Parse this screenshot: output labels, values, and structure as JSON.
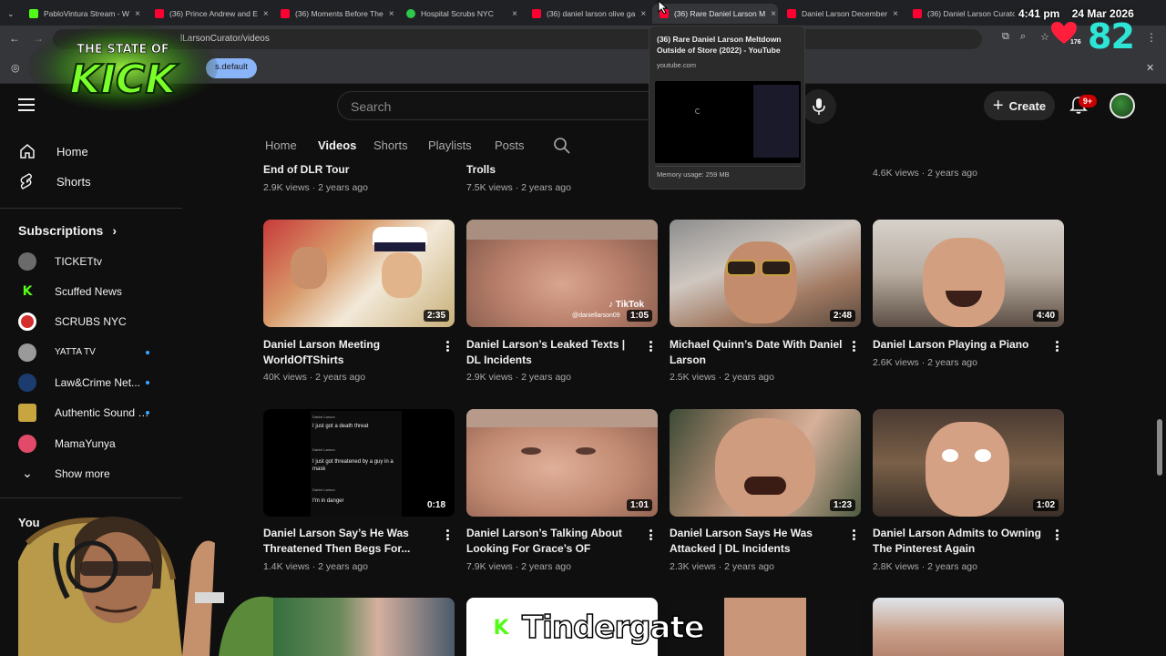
{
  "browser": {
    "tabs": [
      {
        "title": "PabloVintura Stream - W",
        "favicon": "kick"
      },
      {
        "title": "(36) Prince Andrew and E",
        "favicon": "youtube"
      },
      {
        "title": "(36) Moments Before The",
        "favicon": "youtube"
      },
      {
        "title": "Hospital Scrubs NYC",
        "favicon": "green"
      },
      {
        "title": "(36) daniel larson olive ga",
        "favicon": "youtube"
      },
      {
        "title": "(36) Rare Daniel Larson M",
        "favicon": "youtube",
        "active": true
      },
      {
        "title": "Daniel Larson December",
        "favicon": "youtube"
      },
      {
        "title": "(36) Daniel Larson Curato",
        "favicon": "youtube"
      }
    ],
    "url": "lLarsonCurator/videos",
    "bookmark_chip": "s.default"
  },
  "hover_card": {
    "title": "(36) Rare Daniel Larson Meltdown Outside of Store (2022) - YouTube",
    "domain": "youtube.com",
    "memory": "Memory usage: 259 MB"
  },
  "stream_overlay": {
    "logo_text_top": "THE STATE OF",
    "logo_text_main": "KICK",
    "time": "4:41 pm",
    "date": "24 Mar 2026",
    "heart_count": "176",
    "viewer_count": "82",
    "ticker_text": "Tindergate",
    "ticker_logo": "K"
  },
  "youtube": {
    "search_placeholder": "Search",
    "create_label": "Create",
    "notification_badge": "9+",
    "sidebar": {
      "home": "Home",
      "shorts": "Shorts",
      "subscriptions_title": "Subscriptions",
      "subscriptions": [
        {
          "name": "TICKETtv",
          "color": "#6b6b6b",
          "dot": false
        },
        {
          "name": "Scuffed News",
          "color": "#53fc18",
          "dot": false
        },
        {
          "name": "SCRUBS NYC",
          "color": "#d32f2f",
          "dot": false
        },
        {
          "name": "YATTA TV",
          "color": "#9a9a9a",
          "dot": true
        },
        {
          "name": "Law&Crime Net...",
          "color": "#1c3b6e",
          "dot": true
        },
        {
          "name": "Authentic Sound Ef...",
          "color": "#c7a640",
          "dot": true
        },
        {
          "name": "MamaYunya",
          "color": "#e24a6a",
          "dot": false
        }
      ],
      "show_more": "Show more",
      "you_label": "You"
    },
    "channel_tabs": [
      "Home",
      "Videos",
      "Shorts",
      "Playlists",
      "Posts"
    ],
    "active_tab": "Videos",
    "top_row_partial": [
      {
        "title": "End of DLR Tour",
        "meta": "2.9K views · 2 years ago"
      },
      {
        "title": "Trolls",
        "meta": "7.5K views · 2 years ago"
      },
      {
        "title": "",
        "meta": "4.6K views · 2 years ago"
      }
    ],
    "videos_row1": [
      {
        "title": "Daniel Larson Meeting WorldOfTShirts",
        "meta": "40K views · 2 years ago",
        "duration": "2:35"
      },
      {
        "title": "Daniel Larson’s Leaked Texts | DL Incidents",
        "meta": "2.9K views · 2 years ago",
        "duration": "1:05",
        "watermark": "@daniellarson09"
      },
      {
        "title": "Michael Quinn’s Date With Daniel Larson",
        "meta": "2.5K views · 2 years ago",
        "duration": "2:48"
      },
      {
        "title": "Daniel Larson Playing a Piano",
        "meta": "2.6K views · 2 years ago",
        "duration": "4:40"
      }
    ],
    "videos_row2": [
      {
        "title": "Daniel Larson Say’s He Was Threatened Then Begs For...",
        "meta": "1.4K views · 2 years ago",
        "duration": "0:18"
      },
      {
        "title": "Daniel Larson’s Talking About Looking For Grace’s OF",
        "meta": "7.9K views · 2 years ago",
        "duration": "1:01"
      },
      {
        "title": "Daniel Larson Says He Was Attacked | DL Incidents",
        "meta": "2.3K views · 2 years ago",
        "duration": "1:23"
      },
      {
        "title": "Daniel Larson Admits to Owning The Pinterest Again",
        "meta": "2.8K views · 2 years ago",
        "duration": "1:02"
      }
    ],
    "chat_lines": [
      {
        "user": "Daniel Larson",
        "text": "I just got a death threat"
      },
      {
        "user": "Daniel Larson",
        "text": "I just got threatened by a guy in a mask"
      },
      {
        "user": "Daniel Larson",
        "text": "I'm in danger"
      }
    ]
  }
}
